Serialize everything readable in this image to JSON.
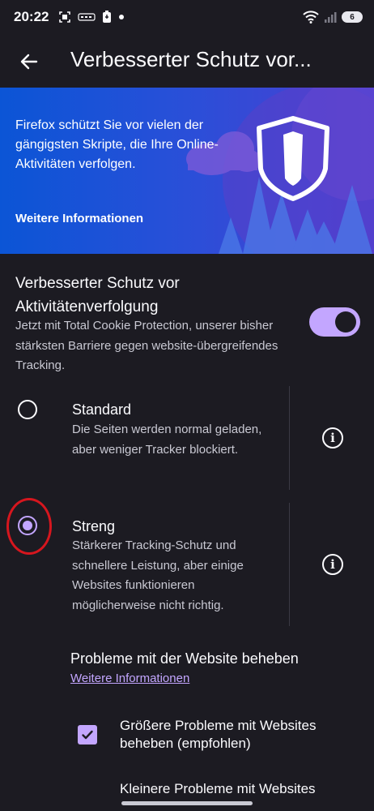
{
  "status_bar": {
    "time": "20:22",
    "left_icons": [
      "screenshot-icon",
      "notification-icon",
      "battery-saver-icon",
      "dot-icon"
    ],
    "right_icons": [
      "wifi-icon",
      "signal-icon"
    ],
    "battery_level": "6"
  },
  "app_bar": {
    "title": "Verbesserter Schutz vor..."
  },
  "banner": {
    "text": "Firefox schützt Sie vor vielen der gängigsten Skripte, die Ihre Online-Aktivitäten verfolgen.",
    "link": "Weitere Informationen"
  },
  "main_setting": {
    "title": "Verbesserter Schutz vor Aktivitätenverfolgung",
    "description": "Jetzt mit Total Cookie Protection, unserer bisher stärksten Barriere gegen website-übergreifendes Tracking.",
    "enabled": true
  },
  "options": [
    {
      "title": "Standard",
      "description": "Die Seiten werden normal geladen, aber weniger Tracker blockiert.",
      "selected": false
    },
    {
      "title": "Streng",
      "description": "Stärkerer Tracking-Schutz und schnellere Leistung, aber einige Websites funktionieren möglicherweise nicht richtig.",
      "selected": true
    }
  ],
  "website_problems": {
    "title": "Probleme mit der Website beheben",
    "link": "Weitere Informationen",
    "checkboxes": [
      {
        "label": "Größere Probleme mit Websites beheben (empfohlen)",
        "checked": true
      },
      {
        "label": "Kleinere Probleme mit Websites",
        "checked": false
      }
    ]
  },
  "colors": {
    "background": "#1c1b22",
    "accent": "#c3a6ff",
    "banner_start": "#0b55d6",
    "banner_end": "#4b3fd2",
    "annotation": "#d6161e"
  }
}
